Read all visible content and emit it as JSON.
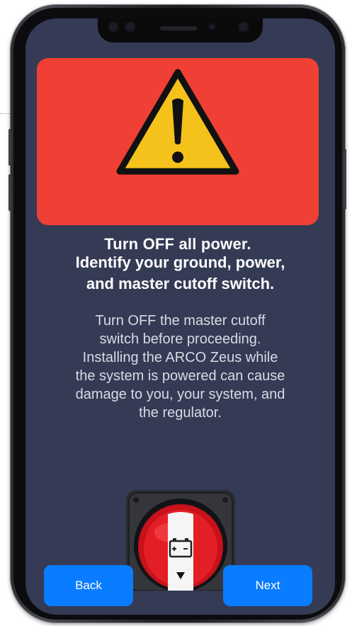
{
  "warning": {
    "title": "Turn OFF all power."
  },
  "heading": "Identify your ground, power,\nand master cutoff switch.",
  "body": "Turn OFF the master cutoff\nswitch before proceeding.\nInstalling the ARCO Zeus while\nthe system is powered can cause\ndamage to you, your system, and\nthe regulator.",
  "buttons": {
    "back": "Back",
    "next": "Next"
  },
  "colors": {
    "screen_background": "#353a55",
    "warning_background": "#f03f34",
    "warning_triangle": "#f5c21b",
    "button_background": "#0a7cff",
    "button_text": "#ffffff"
  },
  "icons": {
    "warning": "warning-triangle-icon",
    "switch": "battery-master-switch",
    "battery": "battery-icon"
  }
}
